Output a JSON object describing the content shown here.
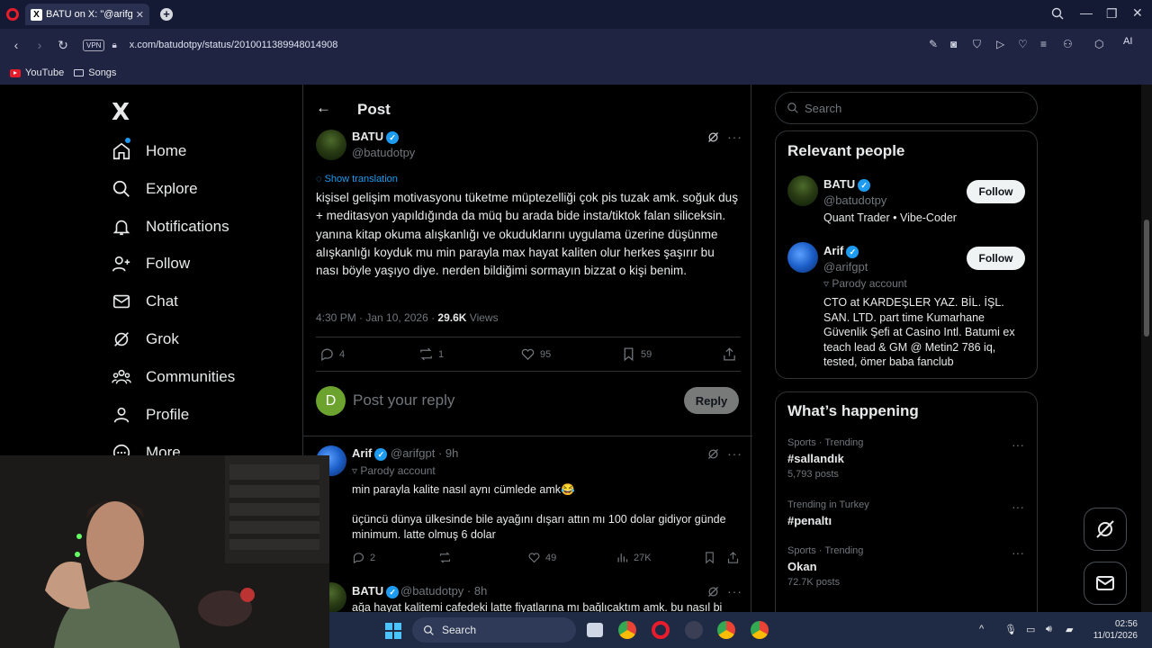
{
  "browser": {
    "tab_title": "BATU on X: \"@arifgpt kişisel",
    "tab_favicon": "X",
    "url": "x.com/batudotpy/status/2010011389948014908",
    "vpn_label": "VPN",
    "ai_label": "AI",
    "bookmarks": [
      {
        "label": "YouTube",
        "icon": "youtube-icon"
      },
      {
        "label": "Songs",
        "icon": "folder-icon"
      }
    ]
  },
  "sidebar": {
    "logo": "X",
    "items": [
      {
        "label": "Home",
        "icon": "home-icon"
      },
      {
        "label": "Explore",
        "icon": "search-icon"
      },
      {
        "label": "Notifications",
        "icon": "bell-icon"
      },
      {
        "label": "Follow",
        "icon": "person-plus-icon"
      },
      {
        "label": "Chat",
        "icon": "mail-icon"
      },
      {
        "label": "Grok",
        "icon": "grok-icon"
      },
      {
        "label": "Communities",
        "icon": "people-icon"
      },
      {
        "label": "Profile",
        "icon": "person-icon"
      },
      {
        "label": "More",
        "icon": "more-circle-icon"
      }
    ]
  },
  "post": {
    "header_title": "Post",
    "author_name": "BATU",
    "author_handle": "@batudotpy",
    "show_translation": "Show translation",
    "text": "kişisel gelişim motivasyonu tüketme müptezelliği çok pis tuzak amk. soğuk duş + meditasyon yapıldığında da müq bu arada bide insta/tiktok falan siliceksin. yanına kitap okuma alışkanlığı ve okuduklarını uygulama üzerine düşünme alışkanlığı koyduk mu min parayla max hayat kaliten olur herkes şaşırır bu nası böyle yaşıyo diye. nerden bildiğimi sormayın bizzat o kişi benim.",
    "time": "4:30 PM · Jan 10, 2026 · ",
    "views_count": "29.6K",
    "views_label": " Views",
    "replies": "4",
    "reposts": "1",
    "likes": "95",
    "bookmarks": "59"
  },
  "reply_box": {
    "avatar_letter": "D",
    "placeholder": "Post your reply",
    "button": "Reply"
  },
  "replies": [
    {
      "name": "Arif",
      "handle_time": "@arifgpt · 9h",
      "parody": "Parody account",
      "line1": "min parayla kalite nasıl aynı cümlede amk😂",
      "line2": "üçüncü dünya ülkesinde bile ayağını dışarı attın mı 100 dolar gidiyor günde minimum. latte olmuş 6 dolar",
      "replies": "2",
      "likes": "49",
      "views": "27K"
    },
    {
      "name": "BATU",
      "handle_time": "@batudotpy · 8h",
      "line1": "ağa hayat kalitemi cafedeki latte fiyatlarına mı bağlıcaktım amk. bu nasıl bi"
    }
  ],
  "right": {
    "search_placeholder": "Search",
    "relevant_title": "Relevant people",
    "people": [
      {
        "name": "BATU",
        "handle": "@batudotpy",
        "bio": "Quant Trader • Vibe-Coder",
        "follow": "Follow"
      },
      {
        "name": "Arif",
        "handle": "@arifgpt",
        "parody": "Parody account",
        "bio": "CTO at KARDEŞLER YAZ. BİL. İŞL. SAN. LTD. part time Kumarhane Güvenlik Şefi at Casino Intl. Batumi ex teach lead & GM @ Metin2 786 iq, tested, ömer baba fanclub",
        "follow": "Follow"
      }
    ],
    "happening_title": "What’s happening",
    "trends": [
      {
        "category": "Sports · Trending",
        "name": "#sallandık",
        "count": "5,793 posts"
      },
      {
        "category": "Trending in Turkey",
        "name": "#penaltı",
        "count": ""
      },
      {
        "category": "Sports · Trending",
        "name": "Okan",
        "count": "72.7K posts"
      }
    ]
  },
  "taskbar": {
    "search_label": "Search",
    "time": "02:56",
    "date": "11/01/2026"
  },
  "colors": {
    "accent": "#1d9bf0",
    "background": "#000000",
    "muted": "#71767b",
    "border": "#2f3336"
  }
}
